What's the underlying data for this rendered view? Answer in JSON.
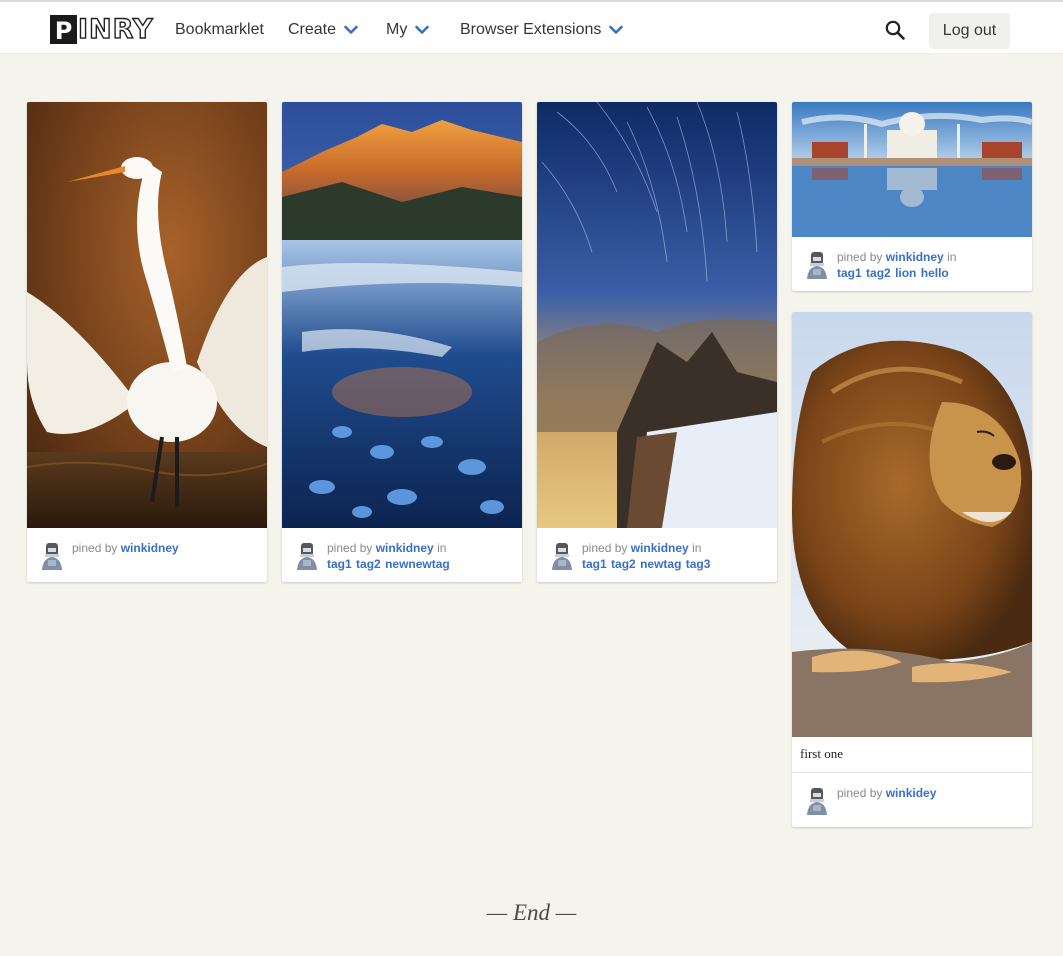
{
  "header": {
    "logo_first": "P",
    "logo_rest": "INRY",
    "nav": {
      "bookmarklet": "Bookmarklet",
      "create": "Create",
      "my": "My",
      "extensions": "Browser Extensions"
    },
    "logout_label": "Log out"
  },
  "pins": {
    "egret": {
      "by_prefix": "pined by",
      "user": "winkidney"
    },
    "glacier": {
      "by_prefix": "pined by",
      "user": "winkidney",
      "in_word": "in",
      "tags": [
        "tag1",
        "tag2",
        "newnewtag"
      ]
    },
    "stars": {
      "by_prefix": "pined by",
      "user": "winkidney",
      "in_word": "in",
      "tags": [
        "tag1",
        "tag2",
        "newtag",
        "tag3"
      ]
    },
    "tajmahal": {
      "by_prefix": "pined by",
      "user": "winkidney",
      "in_word": "in",
      "tags": [
        "tag1",
        "tag2",
        "lion",
        "hello"
      ]
    },
    "lion": {
      "description": "first one",
      "by_prefix": "pined by",
      "user": "winkidey"
    }
  },
  "footer": {
    "end_text": "— End —"
  },
  "colors": {
    "accent": "#3a6fc9",
    "background": "#f4f3ec"
  }
}
